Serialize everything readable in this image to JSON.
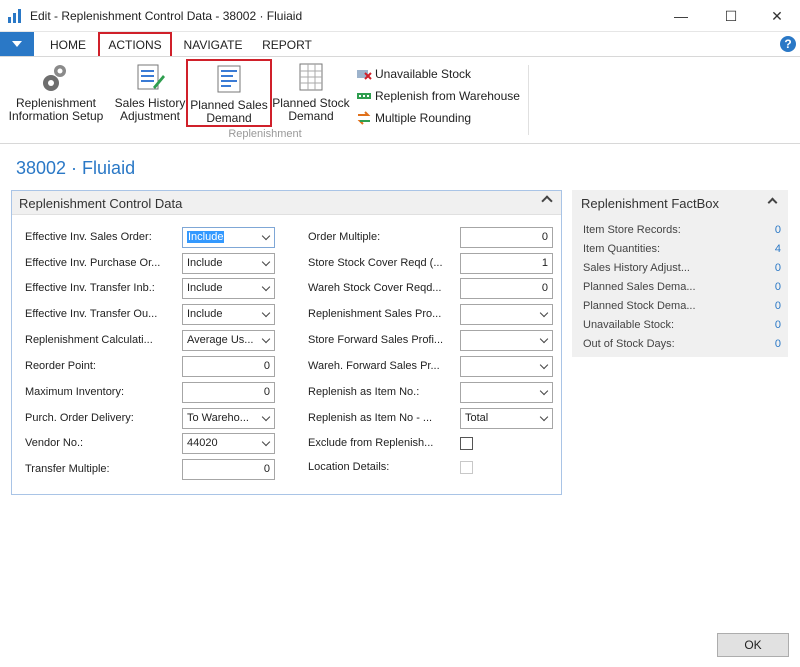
{
  "window": {
    "title": "Edit - Replenishment Control Data - 38002 · Fluiaid",
    "minimize": "—",
    "maximize": "☐",
    "close": "✕"
  },
  "tabs": [
    {
      "label": "HOME"
    },
    {
      "label": "ACTIONS"
    },
    {
      "label": "NAVIGATE"
    },
    {
      "label": "REPORT"
    }
  ],
  "help_label": "?",
  "ribbon": {
    "buttons": [
      {
        "line1": "Replenishment",
        "line2": "Information Setup",
        "icon": "gears-icon"
      },
      {
        "line1": "Sales History",
        "line2": "Adjustment",
        "icon": "edit-list-icon"
      },
      {
        "line1": "Planned Sales",
        "line2": "Demand",
        "icon": "chart-list-icon"
      },
      {
        "line1": "Planned Stock",
        "line2": "Demand",
        "icon": "stock-sheet-icon"
      }
    ],
    "small_actions": [
      {
        "label": "Unavailable Stock",
        "icon": "unavailable-icon"
      },
      {
        "label": "Replenish from Warehouse",
        "icon": "warehouse-icon"
      },
      {
        "label": "Multiple Rounding",
        "icon": "rounding-icon"
      }
    ],
    "group_label": "Replenishment"
  },
  "page_title": "38002 · Fluiaid",
  "panel": {
    "title": "Replenishment Control Data",
    "left_fields": [
      {
        "label": "Effective Inv. Sales Order:",
        "value": "Include",
        "type": "select"
      },
      {
        "label": "Effective Inv. Purchase Or...",
        "value": "Include",
        "type": "select"
      },
      {
        "label": "Effective Inv. Transfer Inb.:",
        "value": "Include",
        "type": "select"
      },
      {
        "label": "Effective Inv. Transfer Ou...",
        "value": "Include",
        "type": "select"
      },
      {
        "label": "Replenishment Calculati...",
        "value": "Average Us...",
        "type": "select"
      },
      {
        "label": "Reorder Point:",
        "value": "0",
        "type": "number"
      },
      {
        "label": "Maximum Inventory:",
        "value": "0",
        "type": "number"
      },
      {
        "label": "Purch. Order Delivery:",
        "value": "To Wareho...",
        "type": "select"
      },
      {
        "label": "Vendor No.:",
        "value": "44020",
        "type": "select"
      },
      {
        "label": "Transfer Multiple:",
        "value": "0",
        "type": "number"
      }
    ],
    "right_fields": [
      {
        "label": "Order Multiple:",
        "value": "0",
        "type": "number"
      },
      {
        "label": "Store Stock Cover Reqd (...",
        "value": "1",
        "type": "number"
      },
      {
        "label": "Wareh Stock Cover Reqd...",
        "value": "0",
        "type": "number"
      },
      {
        "label": "Replenishment Sales Pro...",
        "value": "",
        "type": "select"
      },
      {
        "label": "Store Forward Sales Profi...",
        "value": "",
        "type": "select"
      },
      {
        "label": "Wareh. Forward Sales Pr...",
        "value": "",
        "type": "select"
      },
      {
        "label": "Replenish as Item No.:",
        "value": "",
        "type": "select"
      },
      {
        "label": "Replenish as Item No - ...",
        "value": "Total",
        "type": "select"
      },
      {
        "label": "Exclude from Replenish...",
        "type": "checkbox"
      },
      {
        "label": "Location Details:",
        "type": "checkbox-disabled"
      }
    ]
  },
  "factbox": {
    "title": "Replenishment FactBox",
    "rows": [
      {
        "label": "Item Store Records:",
        "value": "0"
      },
      {
        "label": "Item Quantities:",
        "value": "4"
      },
      {
        "label": "Sales History Adjust...",
        "value": "0"
      },
      {
        "label": "Planned Sales Dema...",
        "value": "0"
      },
      {
        "label": "Planned Stock Dema...",
        "value": "0"
      },
      {
        "label": "Unavailable Stock:",
        "value": "0"
      },
      {
        "label": "Out of Stock Days:",
        "value": "0"
      }
    ]
  },
  "ok_label": "OK",
  "colors": {
    "accent": "#2a78c6",
    "highlight_border": "#d0202a"
  }
}
